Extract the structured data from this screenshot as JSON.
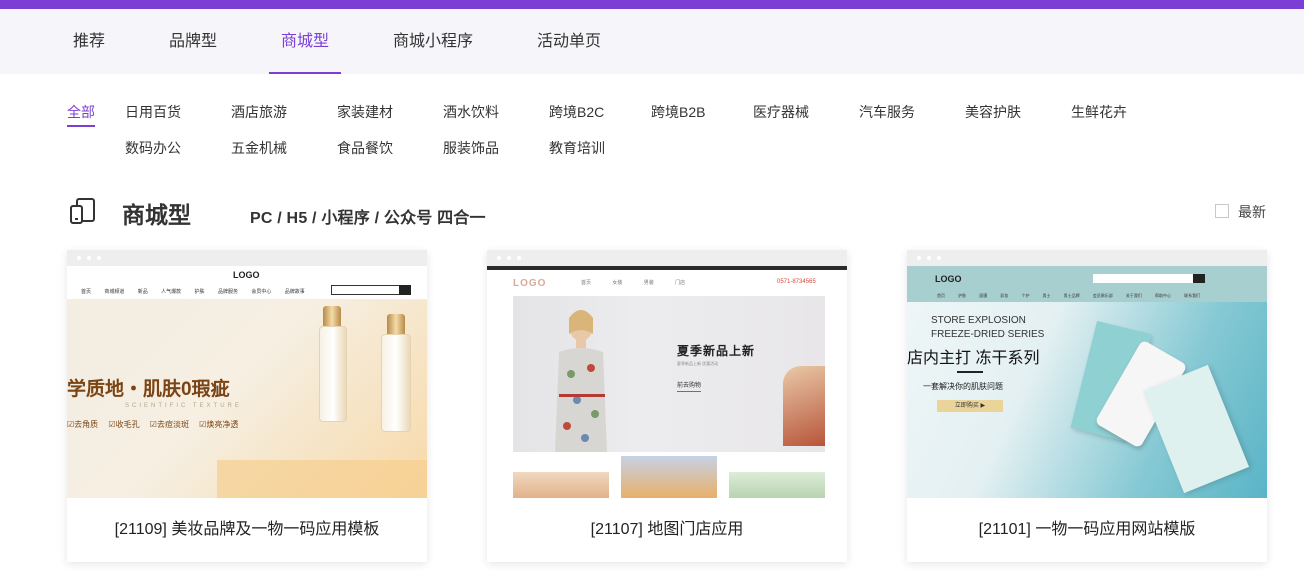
{
  "theme": {
    "accent": "#7b3fd6",
    "tab_bar_bg": "#f6f6fa"
  },
  "tabs": [
    {
      "label": "推荐",
      "active": false
    },
    {
      "label": "品牌型",
      "active": false
    },
    {
      "label": "商城型",
      "active": true
    },
    {
      "label": "商城小程序",
      "active": false
    },
    {
      "label": "活动单页",
      "active": false
    }
  ],
  "categories": {
    "row1": [
      "全部",
      "日用百货",
      "酒店旅游",
      "家装建材",
      "酒水饮料",
      "跨境B2C",
      "跨境B2B",
      "医疗器械",
      "汽车服务",
      "美容护肤",
      "生鲜花卉"
    ],
    "row2": [
      "数码办公",
      "五金机械",
      "食品餐饮",
      "服装饰品",
      "教育培训"
    ],
    "active": "全部"
  },
  "section": {
    "icon": "devices-icon",
    "title": "商城型",
    "subtitle": "PC / H5 / 小程序 / 公众号 四合一",
    "latest_label": "最新"
  },
  "cards": [
    {
      "caption": "[21109] 美妆品牌及一物一码应用模板",
      "thumb": {
        "logo": "LOGO",
        "headline": "学质地・肌肤0瑕疵",
        "subline": "SCIENTIFIC TEXTURE",
        "tags": "☑去角质 ☑收毛孔 ☑去痘淡斑 ☑焕亮净透"
      }
    },
    {
      "caption": "[21107] 地图门店应用",
      "thumb": {
        "logo": "LOGO",
        "phone": "0571-8734565",
        "headline": "夏季新品上新",
        "button": "前去购物"
      }
    },
    {
      "caption": "[21101] 一物一码应用网站模版",
      "thumb": {
        "logo": "LOGO",
        "en_line1": "STORE EXPLOSION",
        "en_line2": "FREEZE-DRIED SERIES",
        "headline": "店内主打 冻干系列",
        "desc": "一套解决你的肌肤问题",
        "button": "立即购买 ▶"
      }
    }
  ]
}
